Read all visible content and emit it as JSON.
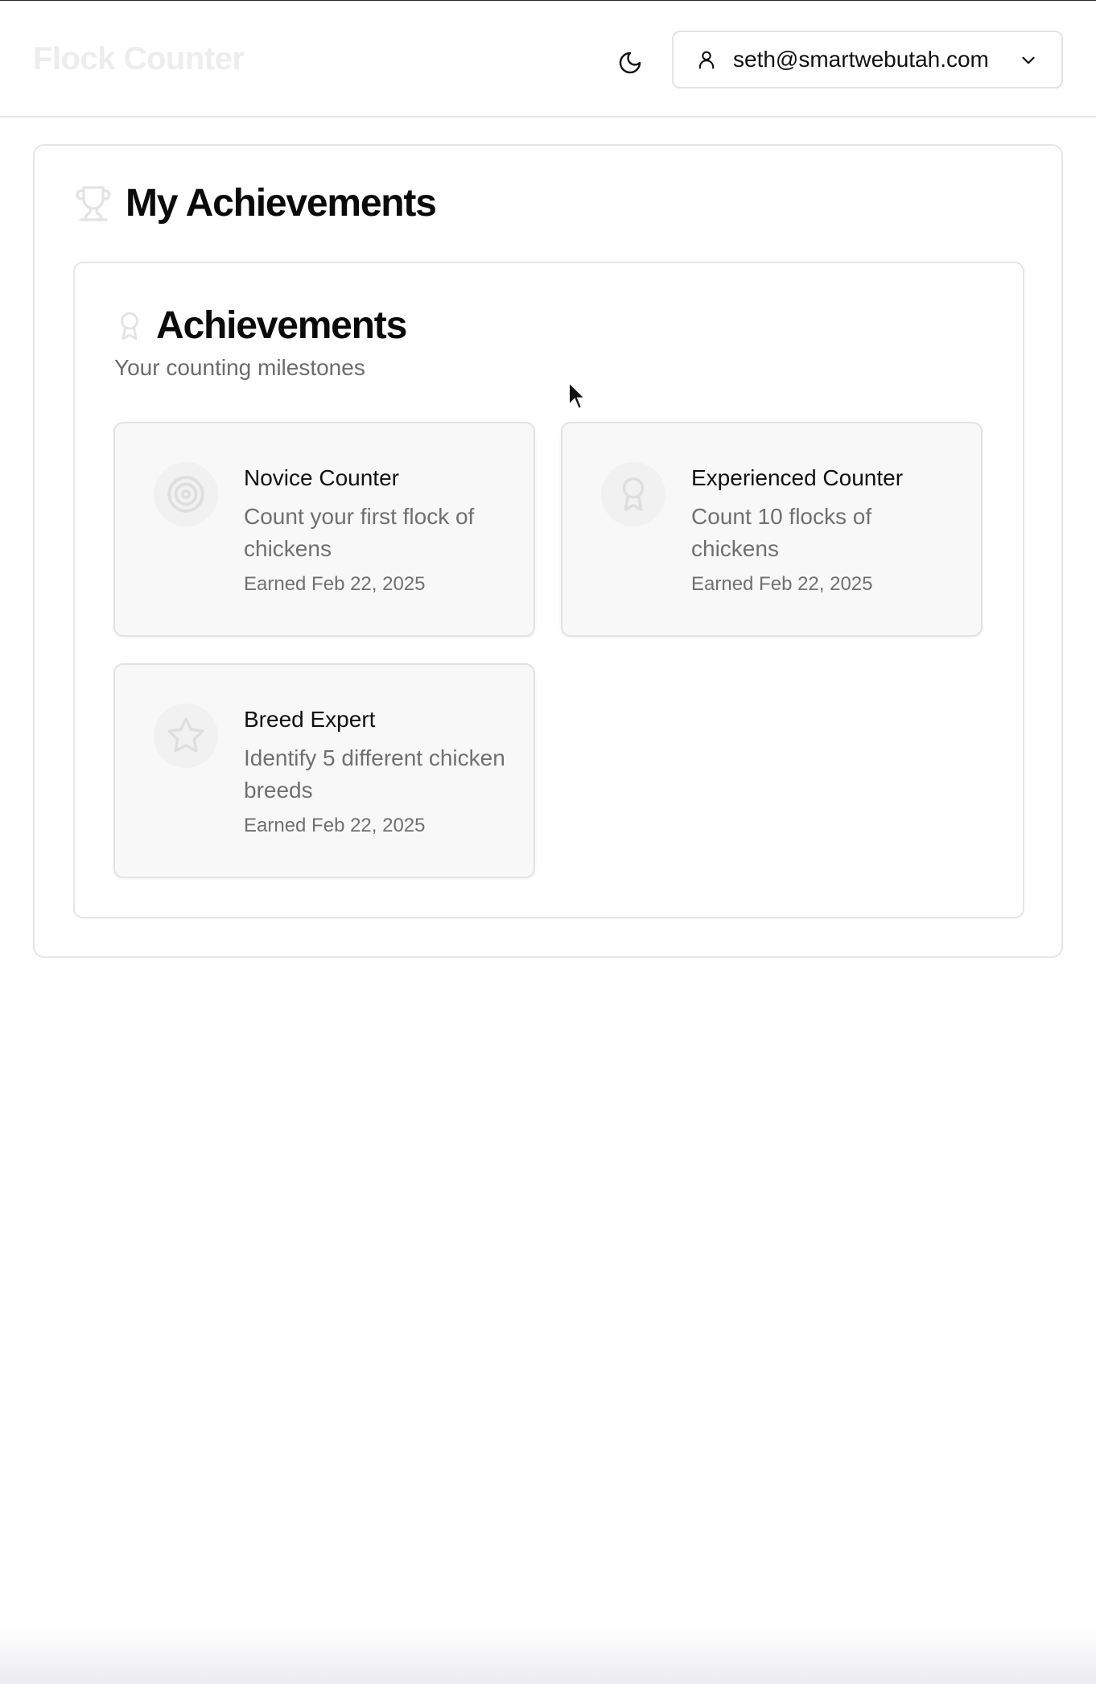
{
  "app": {
    "brand": "Flock Counter"
  },
  "header": {
    "theme_toggle_icon": "moon-icon",
    "user_menu": {
      "email": "seth@smartwebutah.com",
      "user_icon": "user-icon",
      "chevron_icon": "chevron-down-icon"
    }
  },
  "page": {
    "title": "My Achievements",
    "title_icon": "trophy-icon"
  },
  "achievements_section": {
    "title": "Achievements",
    "title_icon": "award-icon",
    "subtitle": "Your counting milestones",
    "items": [
      {
        "name": "Novice Counter",
        "description": "Count your first flock of chickens",
        "earned": "Earned Feb 22, 2025",
        "icon": "target-icon"
      },
      {
        "name": "Experienced Counter",
        "description": "Count 10 flocks of chickens",
        "earned": "Earned Feb 22, 2025",
        "icon": "award-icon"
      },
      {
        "name": "Breed Expert",
        "description": "Identify 5 different chicken breeds",
        "earned": "Earned Feb 22, 2025",
        "icon": "star-icon"
      }
    ]
  },
  "colors": {
    "icon_muted": "#e3e3e3",
    "card_bg": "#f8f8f8",
    "border": "#e6e6e6",
    "muted_text": "#707070"
  }
}
